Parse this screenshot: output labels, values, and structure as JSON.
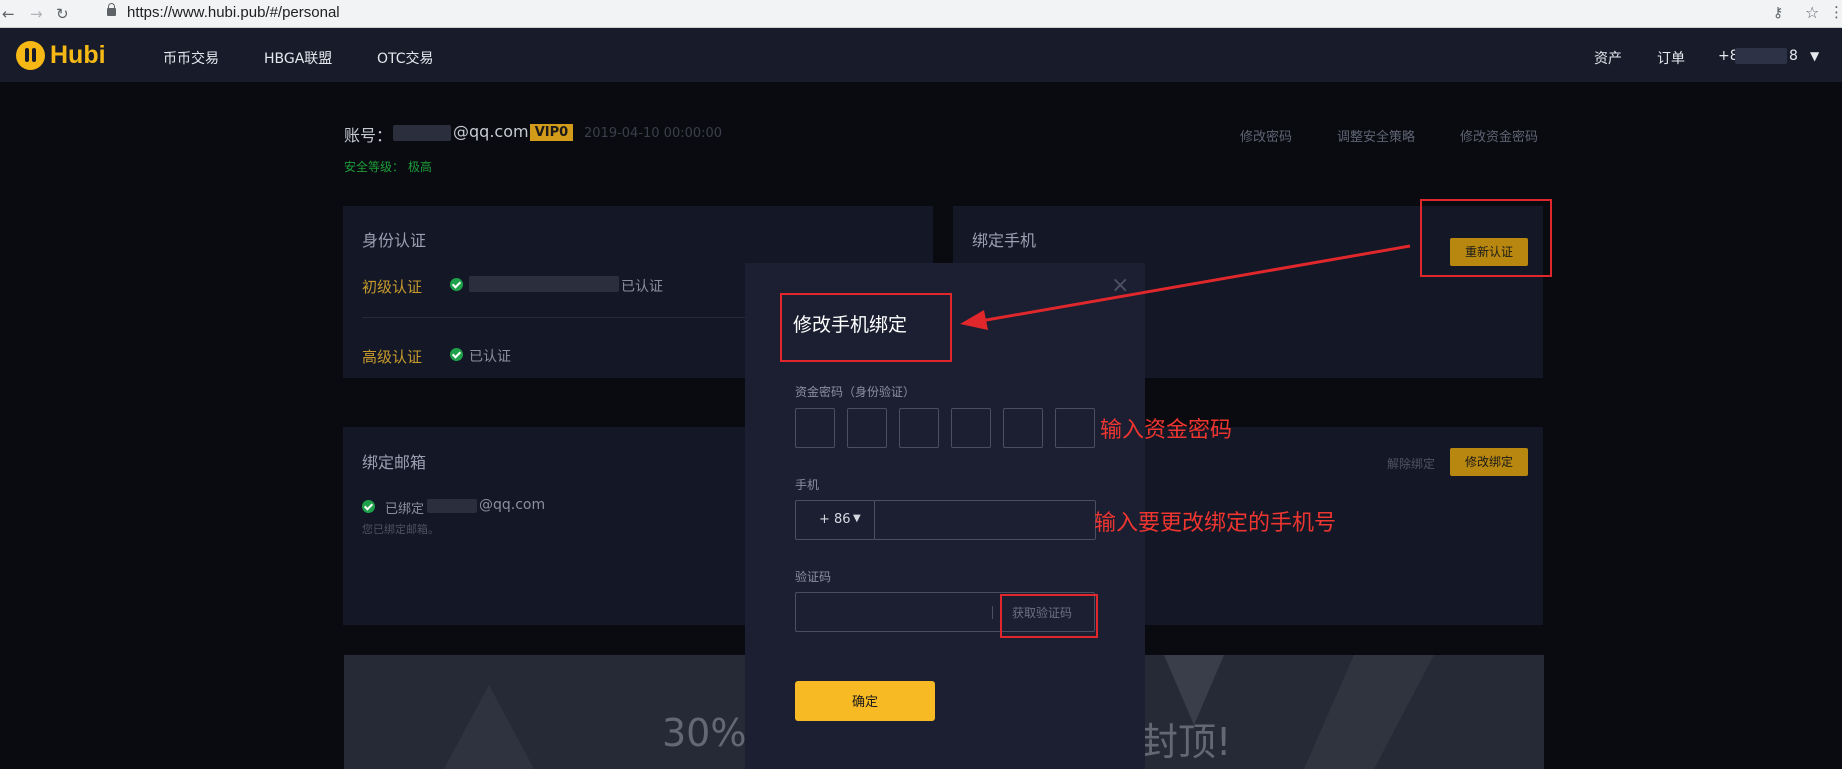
{
  "browser": {
    "url": "https://www.hubi.pub/#/personal"
  },
  "nav": {
    "logo": "Hubi",
    "items": [
      "币币交易",
      "HBGA联盟",
      "OTC交易"
    ],
    "right": {
      "assets": "资产",
      "orders": "订单",
      "phone_start": "+8",
      "phone_end": "8"
    }
  },
  "account": {
    "label": "账号：",
    "email_tail": "@qq.com",
    "vip": "VIP0",
    "date": "2019-04-10 00:00:00",
    "security": "安全等级： 极高",
    "links": [
      "修改密码",
      "调整安全策略",
      "修改资金密码"
    ]
  },
  "identity": {
    "title": "身份认证",
    "basic": "初级认证",
    "basic_status": "已认证",
    "advanced": "高级认证",
    "advanced_status": "已认证"
  },
  "phone_card": {
    "title": "绑定手机",
    "reverify": "重新认证"
  },
  "email_card": {
    "title": "绑定邮箱",
    "bound_prefix": "已绑定",
    "email_tail": "@qq.com",
    "note": "您已绑定邮箱。"
  },
  "email_actions": {
    "unbind": "解除绑定",
    "modify": "修改绑定"
  },
  "banner": {
    "left": "30%",
    "right": "封顶!"
  },
  "modal": {
    "title": "修改手机绑定",
    "close": "×",
    "pin_label": "资金密码（身份验证）",
    "phone_label": "手机",
    "country_code": "+ 86",
    "code_label": "验证码",
    "get_code": "获取验证码",
    "confirm": "确定"
  },
  "annotations": {
    "pin_note": "输入资金密码",
    "phone_note": "输入要更改绑定的手机号"
  },
  "colors": {
    "accent": "#f7b924",
    "nav_bg": "#181b2a",
    "annotation": "#e0272b",
    "success": "#1ea14a"
  }
}
